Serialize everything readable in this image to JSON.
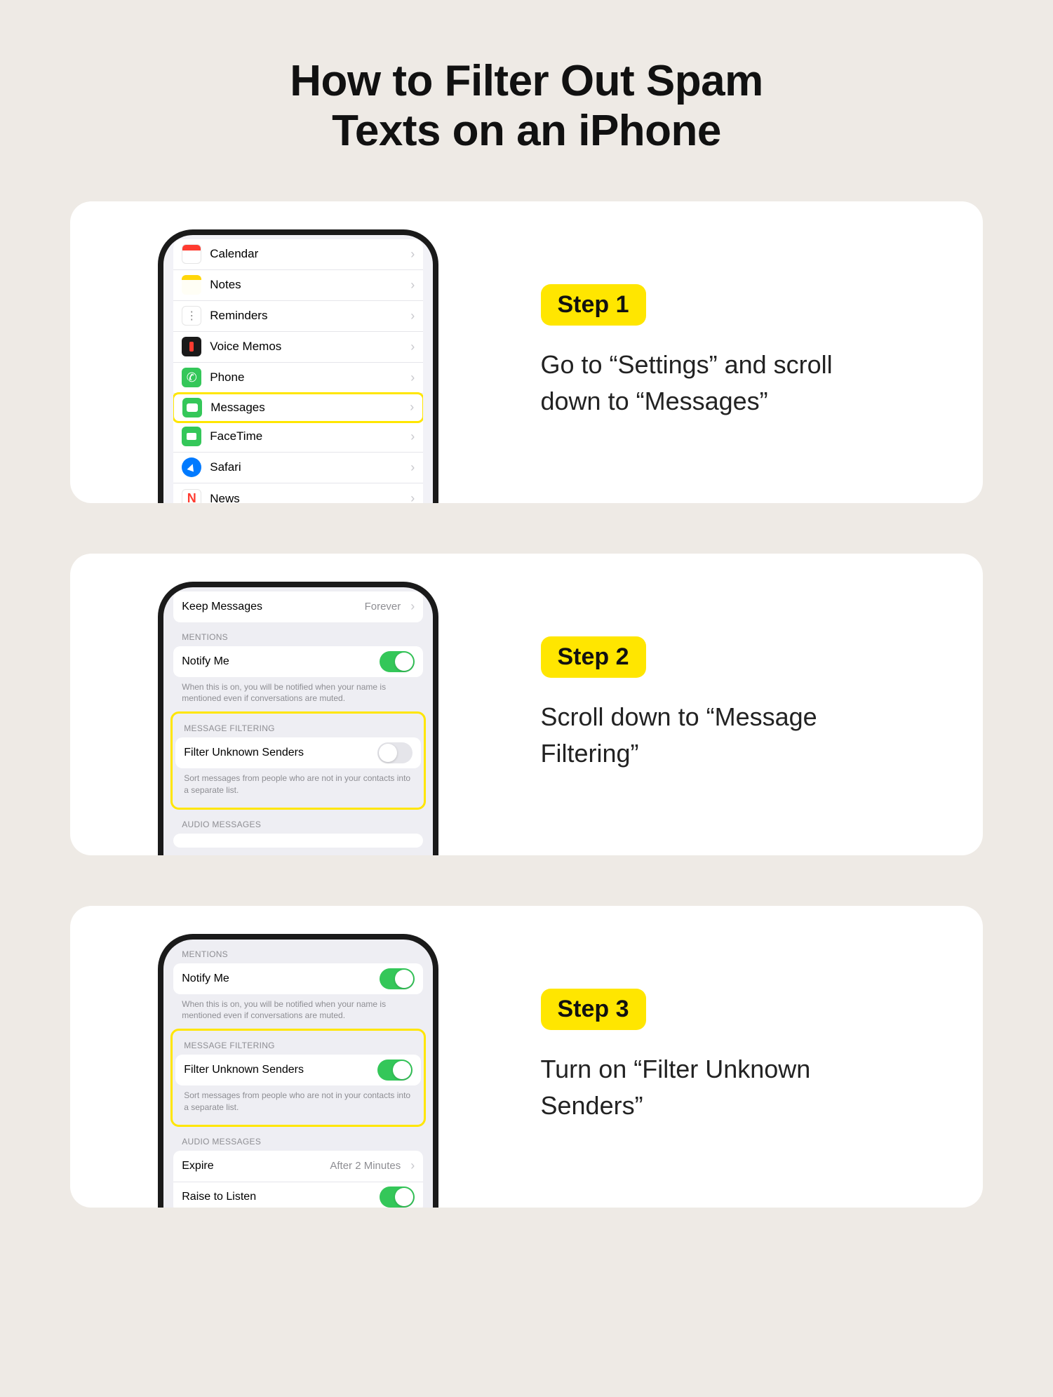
{
  "title_line1": "How to Filter Out Spam",
  "title_line2": "Texts on an iPhone",
  "steps": [
    {
      "badge": "Step 1",
      "desc": "Go to “Settings” and scroll down to “Messages”"
    },
    {
      "badge": "Step 2",
      "desc": "Scroll down to “Message Filtering”"
    },
    {
      "badge": "Step 3",
      "desc": "Turn on “Filter Unknown Senders”"
    }
  ],
  "step1_rows": [
    {
      "icon": "calendar",
      "label": "Calendar"
    },
    {
      "icon": "notes",
      "label": "Notes"
    },
    {
      "icon": "reminders",
      "label": "Reminders"
    },
    {
      "icon": "voice",
      "label": "Voice Memos"
    },
    {
      "icon": "phone",
      "label": "Phone"
    },
    {
      "icon": "messages",
      "label": "Messages",
      "highlight": true
    },
    {
      "icon": "facetime",
      "label": "FaceTime"
    },
    {
      "icon": "safari",
      "label": "Safari"
    },
    {
      "icon": "news",
      "label": "News"
    }
  ],
  "step2": {
    "keep_messages_label": "Keep Messages",
    "keep_messages_value": "Forever",
    "mentions_header": "MENTIONS",
    "notify_me_label": "Notify Me",
    "notify_me_on": true,
    "mentions_footer": "When this is on, you will be notified when your name is mentioned even if conversations are muted.",
    "filtering_header": "MESSAGE FILTERING",
    "filter_unknown_label": "Filter Unknown Senders",
    "filter_unknown_on": false,
    "filtering_footer": "Sort messages from people who are not in your contacts into a separate list.",
    "audio_header": "AUDIO MESSAGES"
  },
  "step3": {
    "mentions_header": "MENTIONS",
    "notify_me_label": "Notify Me",
    "notify_me_on": true,
    "mentions_footer": "When this is on, you will be notified when your name is mentioned even if conversations are muted.",
    "filtering_header": "MESSAGE FILTERING",
    "filter_unknown_label": "Filter Unknown Senders",
    "filter_unknown_on": true,
    "filtering_footer": "Sort messages from people who are not in your contacts into a separate list.",
    "audio_header": "AUDIO MESSAGES",
    "expire_label": "Expire",
    "expire_value": "After 2 Minutes",
    "raise_label": "Raise to Listen",
    "raise_on": true
  }
}
